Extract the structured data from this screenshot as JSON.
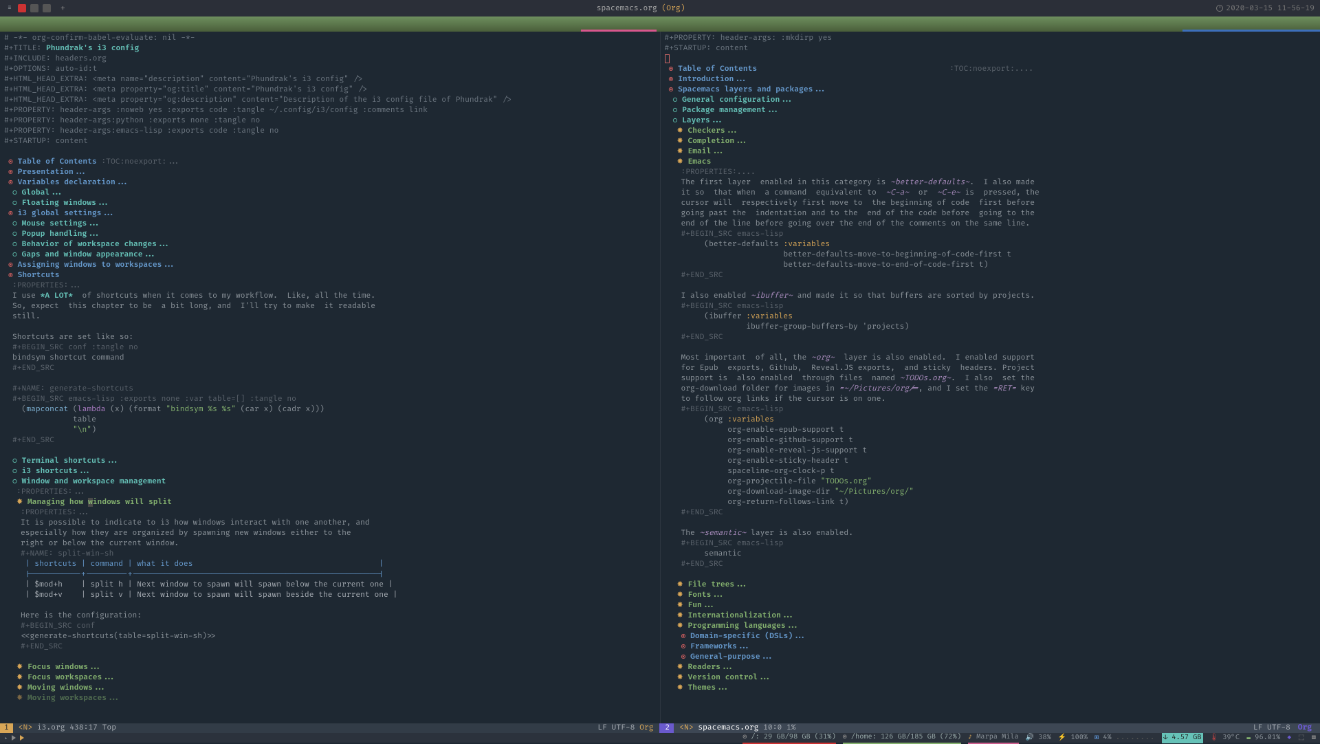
{
  "titlebar": {
    "file": "spacemacs.org",
    "mode": "(Org)",
    "datetime": "2020-03-15 11-56-19"
  },
  "left": {
    "h1": "# -*- org-confirm-babel-evaluate: nil -*-",
    "h2a": "#+TITLE: ",
    "h2b": "Phundrak's i3 config",
    "h3": "#+INCLUDE: headers.org",
    "h4": "#+OPTIONS: auto-id:t",
    "h5": "#+HTML_HEAD_EXTRA: <meta name=\"description\" content=\"Phundrak's i3 config\" />",
    "h6": "#+HTML_HEAD_EXTRA: <meta property=\"og:title\" content=\"Phundrak's i3 config\" />",
    "h7": "#+HTML_HEAD_EXTRA: <meta property=\"og:description\" content=\"Description of the i3 config file of Phundrak\" />",
    "h8a": "#+PROPERTY: header-args :noweb yes :exports code :tangle ~/.config/i3/config :comments link",
    "h8b": "#+PROPERTY: header-args:python :exports none :tangle no",
    "h8c": "#+PROPERTY: header-args:emacs-lisp :exports code :tangle no",
    "h9": "#+STARTUP: content",
    "toc": "Table of Contents",
    "toc_tag": " :TOC:noexport:...",
    "presentation": "Presentation...",
    "vars": "Variables declaration...",
    "global": "Global...",
    "float": "Floating windows...",
    "i3global": "i3 global settings...",
    "mouse": "Mouse settings...",
    "popup": "Popup handling...",
    "behavior": "Behavior of workspace changes...",
    "gaps": "Gaps and window appearance...",
    "assigning": "Assigning windows to workspaces...",
    "shortcuts": "Shortcuts",
    "props": ":PROPERTIES:...",
    "p1a": "I use ",
    "p1b": "*A LOT*",
    "p1c": "  of shortcuts when it comes to my workflow.  Like, all the time.",
    "p2": "So, expect  this chapter to be  a bit long, and  I'll try to make  it readable",
    "p3": "still.",
    "p4": "Shortcuts are set like so:",
    "bs1": "#+BEGIN_SRC conf :tangle no",
    "bs2": "bindsym shortcut command",
    "bs3": "#+END_SRC",
    "name1": "#+NAME: generate-shortcuts",
    "bs4": "#+BEGIN_SRC emacs-lisp :exports none :var table=[] :tangle no",
    "code1a": "  (",
    "code1b": "mapconcat",
    "code1c": " (",
    "code1d": "lambda",
    "code1e": " (x) (format ",
    "code1f": "\"bindsym %s %s\"",
    "code1g": " (car x) (cadr x)))",
    "code2": "             table",
    "code3a": "             ",
    "code3b": "\"\\n\"",
    "code3c": ")",
    "bs5": "#+END_SRC",
    "term": "Terminal shortcuts...",
    "i3s": "i3 shortcuts...",
    "wwm": "Window and workspace management",
    "props2": ":PROPERTIES:...",
    "managing_a": "Managing how ",
    "managing_b": "w",
    "managing_c": "indows will split",
    "props3": ":PROPERTIES:...",
    "para1": "It is possible to indicate to i3 how windows interact with one another, and",
    "para2": "especially how they are organized by spawning new windows either to the",
    "para3": "right or below the current window.",
    "name2": "#+NAME: split-win-sh",
    "th": " | shortcuts | command | what it does                                        |",
    "tdiv": " |-----------+---------+-----------------------------------------------------|",
    "tr1": " | $mod+h    | split h | Next window to spawn will spawn below the current one |",
    "tr2": " | $mod+v    | split v | Next window to spawn will spawn beside the current one |",
    "conf1": "Here is the configuration:",
    "bs6": "#+BEGIN_SRC conf",
    "conf2": "<<generate-shortcuts(table=split-win-sh)>>",
    "bs7": "#+END_SRC",
    "fw": "Focus windows...",
    "fws": "Focus workspaces...",
    "mw": "Moving windows...",
    "mws": "Moving workspaces..."
  },
  "right": {
    "h1a": "#+PROPERTY: header-args: :mkdirp yes",
    "h1b": "#+STARTUP: content",
    "toc": "Table of Contents",
    "toc_tag": ":TOC:noexport:....",
    "intro": "Introduction...",
    "layers": "Spacemacs layers and packages...",
    "genconf": "General configuration...",
    "pkg": "Package management...",
    "layers2": "Layers...",
    "checkers": "Checkers...",
    "completion": "Completion...",
    "email": "Email...",
    "emacs": "Emacs",
    "props": ":PROPERTIES:....",
    "p1a": "The first layer  enabled in this category is ",
    "p1b": "~better-defaults~",
    "p1c": ".  I also made",
    "p2a": "it so  that when  a command  equivalent to  ",
    "p2b": "~C-a~",
    "p2c": "  or  ",
    "p2d": "~C-e~",
    "p2e": " is  pressed, the",
    "p3": "cursor will  respectively first move to  the beginning of code  first before",
    "p4": "going past the  indentation and to the  end of the code before  going to the",
    "p5": "end of the line before going over the end of the comments on the same line.",
    "bs1": "#+BEGIN_SRC emacs-lisp",
    "c1a": "     (better-defaults ",
    "c1b": ":variables",
    "c2": "                      better-defaults-move-to-beginning-of-code-first t",
    "c3": "                      better-defaults-move-to-end-of-code-first t)",
    "bs2": "#+END_SRC",
    "p6a": "I also enabled ",
    "p6b": "~ibuffer~",
    "p6c": " and made it so that buffers are sorted by projects.",
    "bs3": "#+BEGIN_SRC emacs-lisp",
    "c4a": "     (ibuffer ",
    "c4b": ":variables",
    "c5": "              ibuffer-group-buffers-by 'projects)",
    "bs4": "#+END_SRC",
    "p7a": "Most important  of all, the ",
    "p7b": "~org~",
    "p7c": "  layer is also enabled.  I enabled support",
    "p8": "for Epub  exports, Github,  Reveal.JS exports,  and sticky  headers. Project",
    "p9a": "support is  also enabled  through files  named ",
    "p9b": "~TODOs.org~",
    "p9c": ".  I also  set the",
    "p10a": "org-download folder for images in ",
    "p10b": "=~/Pictures/org/=",
    "p10c": ", and I set the ",
    "p10d": "=RET=",
    "p10e": " key",
    "p11": "to follow org links if the cursor is on one.",
    "bs5": "#+BEGIN_SRC emacs-lisp",
    "c6a": "     (org ",
    "c6b": ":variables",
    "c7": "          org-enable-epub-support t",
    "c8": "          org-enable-github-support t",
    "c9": "          org-enable-reveal-js-support t",
    "c10": "          org-enable-sticky-header t",
    "c11": "          spaceline-org-clock-p t",
    "c12a": "          org-projectile-file ",
    "c12b": "\"TODOs.org\"",
    "c13a": "          org-download-image-dir ",
    "c13b": "\"~/Pictures/org/\"",
    "c14": "          org-return-follows-link t)",
    "bs6": "#+END_SRC",
    "p12a": "The ",
    "p12b": "~semantic~",
    "p12c": " layer is also enabled.",
    "bs7": "#+BEGIN_SRC emacs-lisp",
    "c15": "     semantic",
    "bs8": "#+END_SRC",
    "ft": "File trees...",
    "fonts": "Fonts...",
    "fun": "Fun...",
    "intl": "Internationalization...",
    "prog": "Programming languages...",
    "dsl": "Domain-specific (DSLs)...",
    "fw": "Frameworks...",
    "gp": "General-purpose...",
    "readers": "Readers...",
    "vc": "Version control...",
    "themes": "Themes..."
  },
  "modeline": {
    "left": {
      "num": "1",
      "state": "<N>",
      "file": "i3.org",
      "pos": "438:17 Top",
      "enc": "LF UTF-8",
      "mode": "Org"
    },
    "right": {
      "num": "2",
      "state": "<N>",
      "file": "spacemacs.org",
      "pos": "10:0  1%",
      "enc": "LF UTF-8",
      "mode": "Org"
    }
  },
  "bottom": {
    "disk1": "/: 29 GB/98 GB (31%)",
    "disk2": "/home: 126 GB/185 GB (72%)",
    "music": "Marpa Mila",
    "vol": "38%",
    "bat": "100%",
    "cpu": "4%",
    "net": "4.57 GB",
    "temp": "39°C",
    "mem": "96.01%"
  }
}
